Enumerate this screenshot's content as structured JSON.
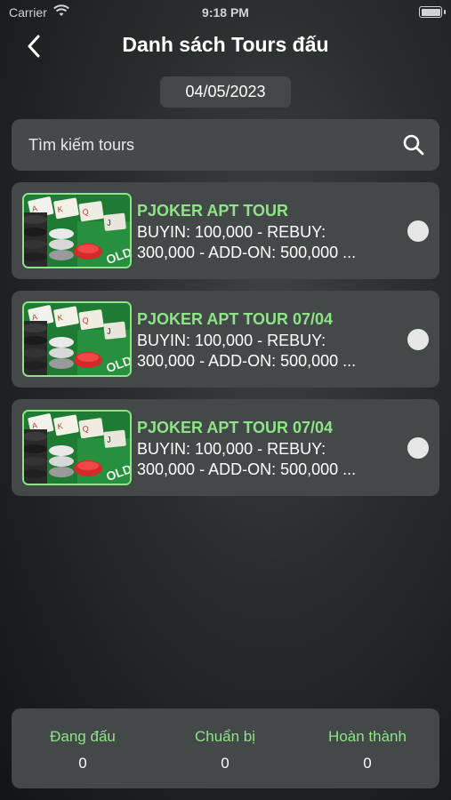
{
  "status_bar": {
    "carrier": "Carrier",
    "time": "9:18 PM"
  },
  "header": {
    "title": "Danh sách Tours đấu",
    "back_icon": "chevron-left-icon"
  },
  "date_filter": {
    "value": "04/05/2023"
  },
  "search": {
    "placeholder": "Tìm kiếm tours",
    "icon": "search-icon"
  },
  "tours": [
    {
      "name": "PJOKER APT TOUR",
      "desc_line1": "BUYIN: 100,000 - REBUY:",
      "desc_line2": "300,000 - ADD-ON: 500,000 ..."
    },
    {
      "name": "PJOKER APT TOUR 07/04",
      "desc_line1": "BUYIN: 100,000 - REBUY:",
      "desc_line2": "300,000 - ADD-ON: 500,000 ..."
    },
    {
      "name": "PJOKER APT TOUR 07/04",
      "desc_line1": "BUYIN: 100,000 - REBUY:",
      "desc_line2": "300,000 - ADD-ON: 500,000 ..."
    }
  ],
  "stats": [
    {
      "label": "Đang đấu",
      "value": "0"
    },
    {
      "label": "Chuẩn bị",
      "value": "0"
    },
    {
      "label": "Hoàn thành",
      "value": "0"
    }
  ],
  "colors": {
    "accent": "#8ee486",
    "card": "#434848",
    "radio": "#e6e6e6"
  }
}
